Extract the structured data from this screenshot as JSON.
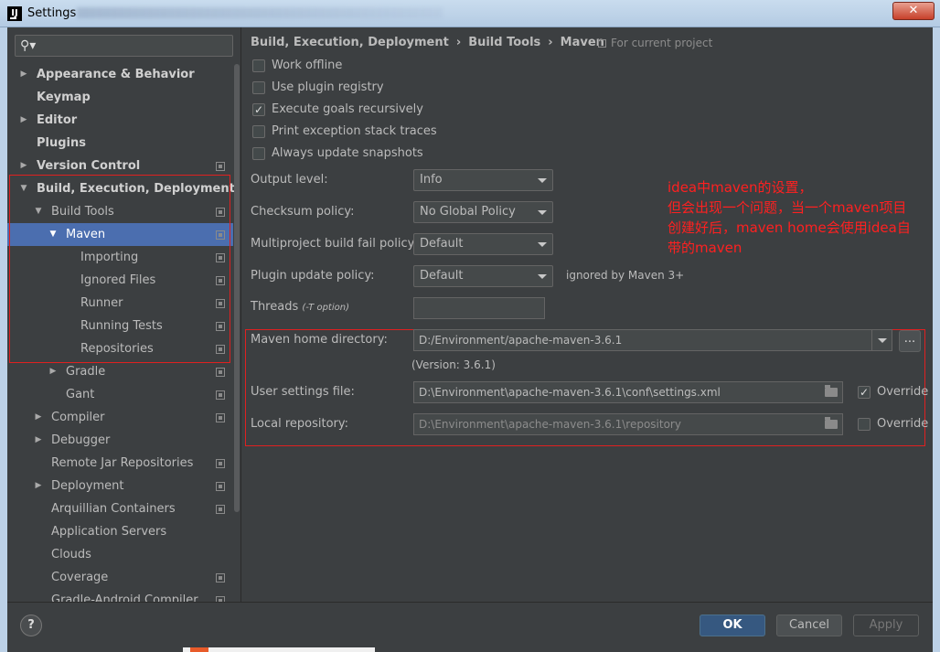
{
  "window": {
    "title": "Settings",
    "close": "✕"
  },
  "search": {
    "icon": "search-icon",
    "placeholder": ""
  },
  "sidebar": {
    "items": [
      {
        "label": "Appearance & Behavior",
        "bold": true,
        "arrow": "▶",
        "indent": 0,
        "copy": false
      },
      {
        "label": "Keymap",
        "bold": true,
        "arrow": "",
        "indent": 0,
        "copy": false
      },
      {
        "label": "Editor",
        "bold": true,
        "arrow": "▶",
        "indent": 0,
        "copy": false
      },
      {
        "label": "Plugins",
        "bold": true,
        "arrow": "",
        "indent": 0,
        "copy": false
      },
      {
        "label": "Version Control",
        "bold": true,
        "arrow": "▶",
        "indent": 0,
        "copy": true
      },
      {
        "label": "Build, Execution, Deployment",
        "bold": true,
        "arrow": "▼",
        "indent": 0,
        "copy": false
      },
      {
        "label": "Build Tools",
        "bold": false,
        "arrow": "▼",
        "indent": 1,
        "copy": true
      },
      {
        "label": "Maven",
        "bold": false,
        "arrow": "▼",
        "indent": 2,
        "copy": true,
        "selected": true
      },
      {
        "label": "Importing",
        "bold": false,
        "arrow": "",
        "indent": 3,
        "copy": true
      },
      {
        "label": "Ignored Files",
        "bold": false,
        "arrow": "",
        "indent": 3,
        "copy": true
      },
      {
        "label": "Runner",
        "bold": false,
        "arrow": "",
        "indent": 3,
        "copy": true
      },
      {
        "label": "Running Tests",
        "bold": false,
        "arrow": "",
        "indent": 3,
        "copy": true
      },
      {
        "label": "Repositories",
        "bold": false,
        "arrow": "",
        "indent": 3,
        "copy": true
      },
      {
        "label": "Gradle",
        "bold": false,
        "arrow": "▶",
        "indent": 2,
        "copy": true
      },
      {
        "label": "Gant",
        "bold": false,
        "arrow": "",
        "indent": 2,
        "copy": true
      },
      {
        "label": "Compiler",
        "bold": false,
        "arrow": "▶",
        "indent": 1,
        "copy": true
      },
      {
        "label": "Debugger",
        "bold": false,
        "arrow": "▶",
        "indent": 1,
        "copy": false
      },
      {
        "label": "Remote Jar Repositories",
        "bold": false,
        "arrow": "",
        "indent": 1,
        "copy": true
      },
      {
        "label": "Deployment",
        "bold": false,
        "arrow": "▶",
        "indent": 1,
        "copy": true
      },
      {
        "label": "Arquillian Containers",
        "bold": false,
        "arrow": "",
        "indent": 1,
        "copy": true
      },
      {
        "label": "Application Servers",
        "bold": false,
        "arrow": "",
        "indent": 1,
        "copy": false
      },
      {
        "label": "Clouds",
        "bold": false,
        "arrow": "",
        "indent": 1,
        "copy": false
      },
      {
        "label": "Coverage",
        "bold": false,
        "arrow": "",
        "indent": 1,
        "copy": true
      },
      {
        "label": "Gradle-Android Compiler",
        "bold": false,
        "arrow": "",
        "indent": 1,
        "copy": true
      }
    ]
  },
  "breadcrumb": [
    "Build, Execution, Deployment",
    "Build Tools",
    "Maven"
  ],
  "breadcrumb_sep": "›",
  "scope": "For current project",
  "checkboxes": [
    {
      "label": "Work offline",
      "checked": false
    },
    {
      "label": "Use plugin registry",
      "checked": false
    },
    {
      "label": "Execute goals recursively",
      "checked": true
    },
    {
      "label": "Print exception stack traces",
      "checked": false
    },
    {
      "label": "Always update snapshots",
      "checked": false
    }
  ],
  "combos": [
    {
      "label": "Output level:",
      "value": "Info"
    },
    {
      "label": "Checksum policy:",
      "value": "No Global Policy"
    },
    {
      "label": "Multiproject build fail policy:",
      "value": "Default"
    },
    {
      "label": "Plugin update policy:",
      "value": "Default"
    }
  ],
  "plugin_hint": "ignored by Maven 3+",
  "threads": {
    "label": "Threads",
    "hint": "(-T option)",
    "value": ""
  },
  "maven_home": {
    "label": "Maven home directory:",
    "value": "D:/Environment/apache-maven-3.6.1",
    "version": "(Version: 3.6.1)",
    "browse": "..."
  },
  "user_settings": {
    "label": "User settings file:",
    "value": "D:\\Environment\\apache-maven-3.6.1\\conf\\settings.xml",
    "override": "Override",
    "checked": true
  },
  "local_repo": {
    "label": "Local repository:",
    "value": "D:\\Environment\\apache-maven-3.6.1\\repository",
    "override": "Override",
    "checked": false
  },
  "annotation": [
    "idea中maven的设置，",
    "但会出现一个问题，当一个maven项目",
    "创建好后，maven home会使用idea自",
    "带的maven"
  ],
  "buttons": {
    "help": "?",
    "ok": "OK",
    "cancel": "Cancel",
    "apply": "Apply"
  }
}
